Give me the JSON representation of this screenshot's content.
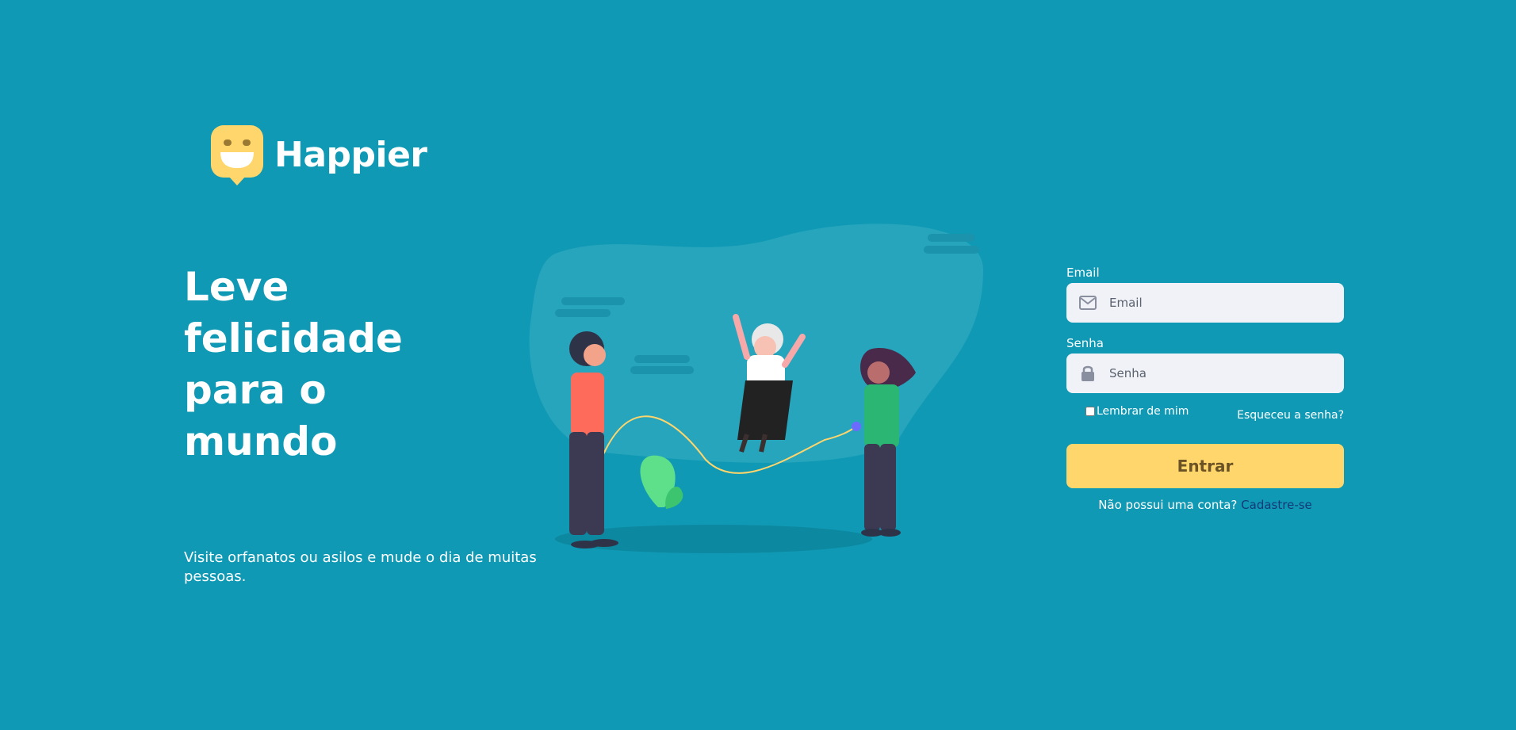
{
  "brand": {
    "name": "Happier",
    "logo_icon": "smile-face-icon",
    "logo_color": "#ffd66b"
  },
  "hero": {
    "headline": "Leve\nfelicidade\npara o\nmundo",
    "subtitle": "Visite orfanatos ou asilos e mude o dia de muitas pessoas."
  },
  "illustration": {
    "name": "kids-jumping-rope-illustration"
  },
  "login": {
    "email_label": "Email",
    "email_placeholder": "Email",
    "email_value": "",
    "email_icon": "envelope-icon",
    "password_label": "Senha",
    "password_placeholder": "Senha",
    "password_value": "",
    "password_icon": "lock-icon",
    "remember_label": "Lembrar de mim",
    "remember_checked": false,
    "forgot_link": "Esqueceu a senha?",
    "submit_label": "Entrar",
    "signup_text": "Não possui uma conta?",
    "signup_link": "Cadastre-se"
  },
  "colors": {
    "background": "#1099b4",
    "accent": "#ffd66b",
    "input_bg": "#f0f2f7",
    "link": "#123a7a"
  }
}
